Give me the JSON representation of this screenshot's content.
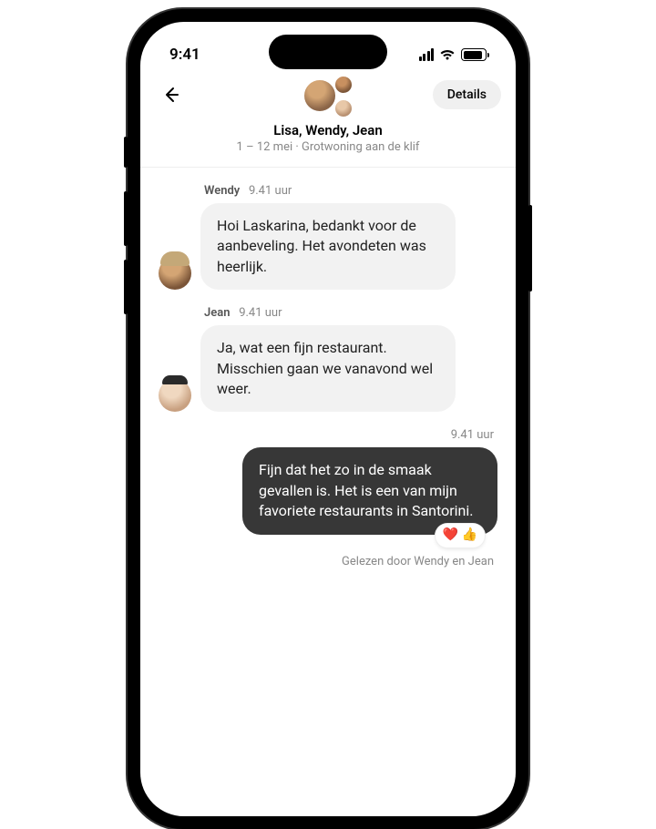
{
  "status": {
    "time": "9:41"
  },
  "header": {
    "details_label": "Details",
    "title": "Lisa, Wendy, Jean",
    "subtitle": "1 – 12 mei · Grotwoning aan de klif"
  },
  "messages": [
    {
      "sender": "Wendy",
      "time": "9.41 uur",
      "text": "Hoi Laskarina, bedankt voor de aanbeveling. Het avondeten was heerlijk."
    },
    {
      "sender": "Jean",
      "time": "9.41 uur",
      "text": "Ja, wat een fijn restaurant. Misschien gaan we vanavond wel weer."
    }
  ],
  "outgoing": {
    "time": "9.41 uur",
    "text": "Fijn dat het zo in de smaak gevallen is. Het is een van mijn favoriete restaurants in Santorini.",
    "reactions": "❤️ 👍",
    "read_by": "Gelezen door Wendy en Jean"
  }
}
